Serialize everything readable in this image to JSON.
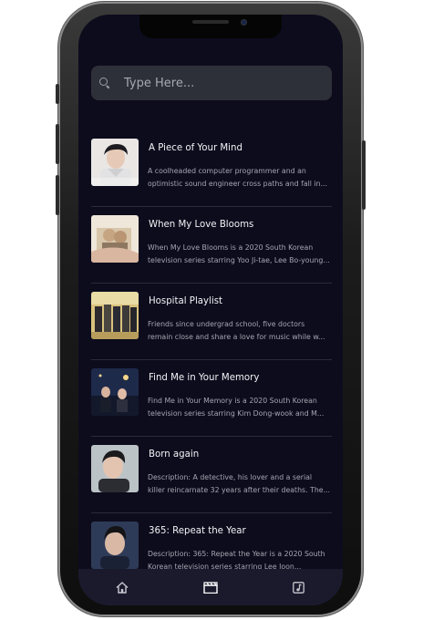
{
  "search": {
    "placeholder": "Type Here..."
  },
  "dramas": [
    {
      "title": "A Piece of Your Mind",
      "description": "A coolheaded computer programmer and an optimistic sound engineer cross paths and fall in...",
      "poster_caption": "Piece of Your Mind"
    },
    {
      "title": "When My Love Blooms",
      "description": "When My Love Blooms is a 2020 South Korean television series starring Yoo Ji-tae, Lee Bo-young...",
      "poster_caption": ""
    },
    {
      "title": "Hospital Playlist",
      "description": "Friends since undergrad school, five doctors remain close and share a love for music while w...",
      "poster_caption": ""
    },
    {
      "title": "Find Me in Your Memory",
      "description": "Find Me in Your Memory is a 2020 South Korean television series starring Kim Dong-wook and M...",
      "poster_caption": ""
    },
    {
      "title": "Born again",
      "description": "Description: A detective, his lover and a serial killer reincarnate 32 years after their deaths. The...",
      "poster_caption": ""
    },
    {
      "title": "365: Repeat the Year",
      "description": "Description: 365: Repeat the Year is a 2020 South Korean television series starring Lee Joon...",
      "poster_caption": ""
    }
  ],
  "nav": {
    "items": [
      {
        "icon": "home-icon",
        "active": false
      },
      {
        "icon": "clapperboard-icon",
        "active": true
      },
      {
        "icon": "music-note-icon",
        "active": false
      }
    ]
  },
  "colors": {
    "background": "#0d0c1d",
    "search_bg": "#2e3039",
    "nav_bg": "#1b1a2d",
    "title": "#f2f2f5",
    "description": "#a4a5b0",
    "active_icon": "#ffffff",
    "inactive_icon": "#c8c8d0"
  }
}
